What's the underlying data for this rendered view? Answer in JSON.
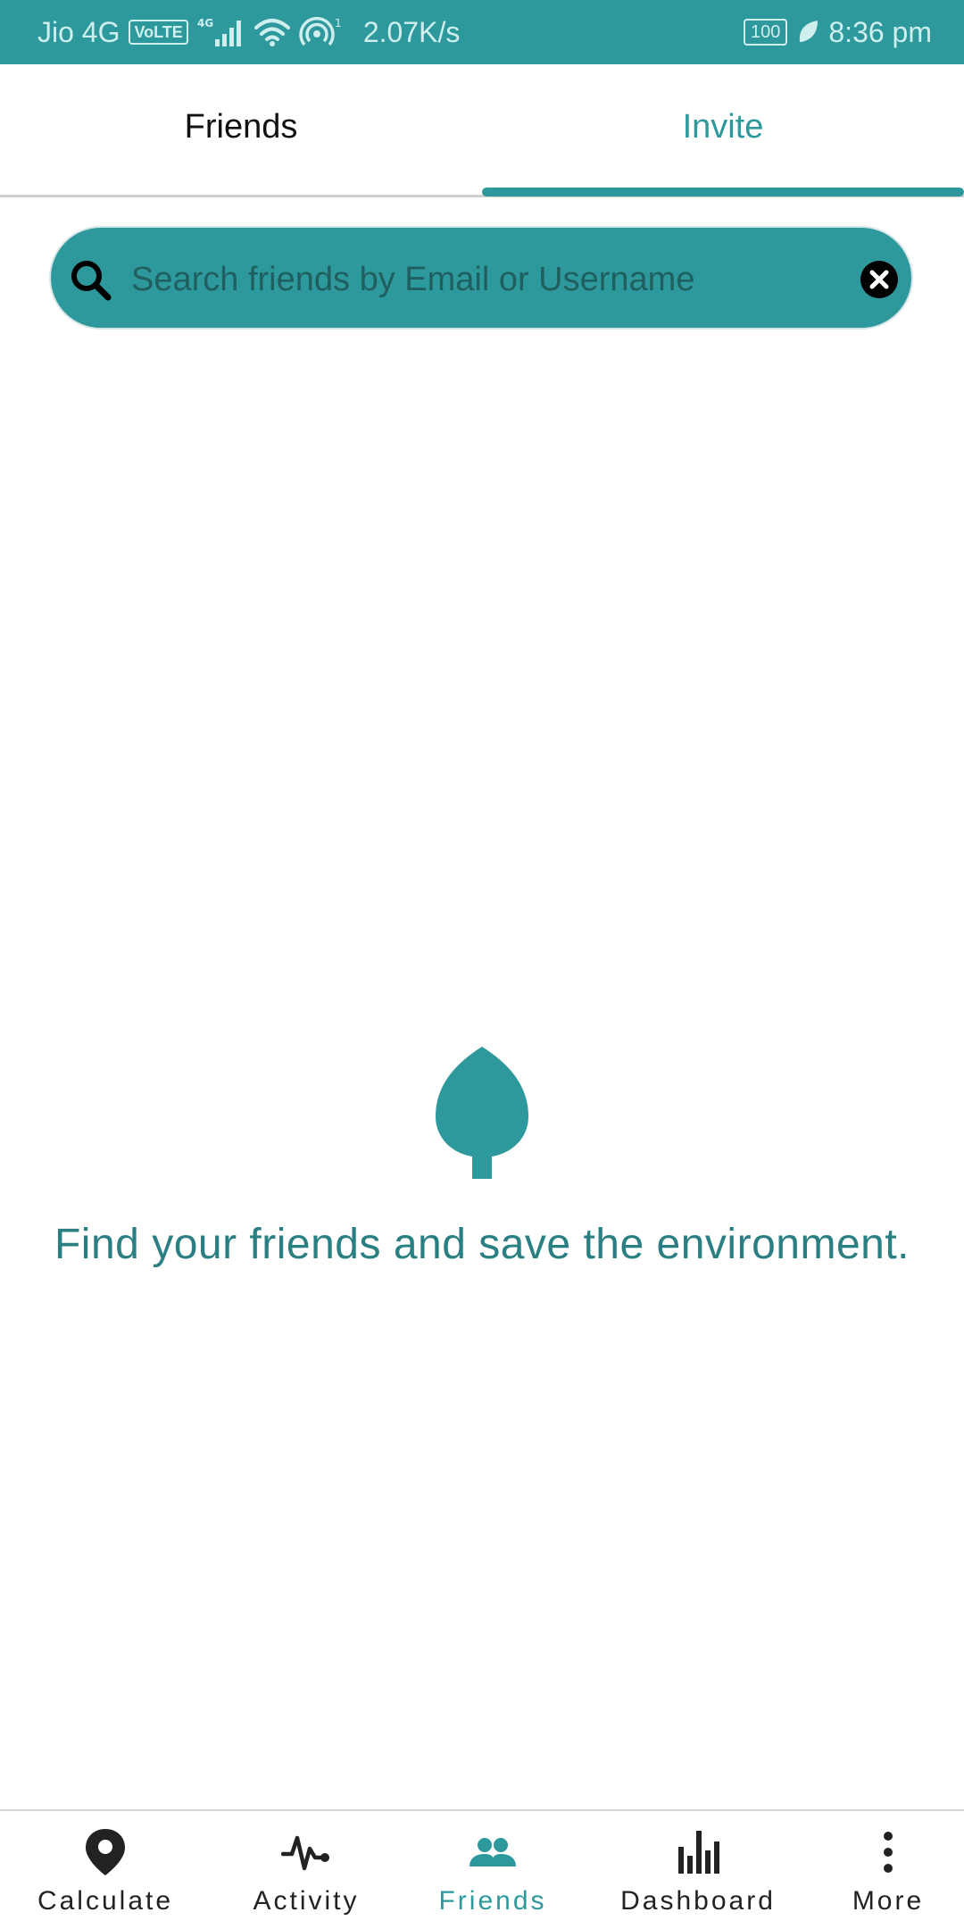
{
  "status_bar": {
    "carrier": "Jio 4G",
    "volte_badge": "VoLTE",
    "network_speed": "2.07K/s",
    "battery": "100",
    "time": "8:36 pm"
  },
  "tabs": [
    {
      "label": "Friends",
      "selected": false
    },
    {
      "label": "Invite",
      "selected": true
    }
  ],
  "search": {
    "placeholder": "Search friends by Email or Username",
    "value": ""
  },
  "empty_state": {
    "icon": "leaf-icon",
    "message": "Find your friends and save the environment."
  },
  "bottom_nav": [
    {
      "label": "Calculate",
      "icon": "location-pin-icon",
      "active": false
    },
    {
      "label": "Activity",
      "icon": "activity-pulse-icon",
      "active": false
    },
    {
      "label": "Friends",
      "icon": "people-icon",
      "active": true
    },
    {
      "label": "Dashboard",
      "icon": "bar-chart-icon",
      "active": false
    },
    {
      "label": "More",
      "icon": "more-vertical-icon",
      "active": false
    }
  ],
  "colors": {
    "accent": "#2e999c",
    "text_dark": "#222222",
    "message_text": "#2a7f82"
  }
}
